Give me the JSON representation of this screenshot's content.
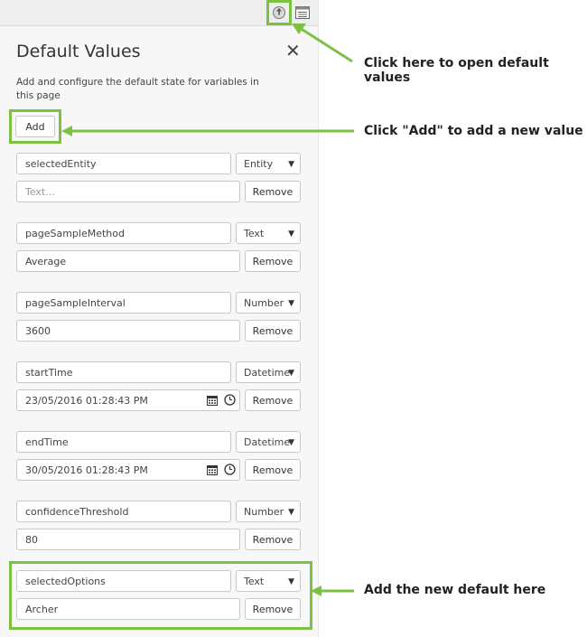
{
  "panel": {
    "title": "Default Values",
    "description": "Add and configure the default state for variables in this page",
    "add_label": "Add",
    "remove_label": "Remove",
    "rows": [
      {
        "name": "selectedEntity",
        "type": "Entity",
        "value": "",
        "placeholder": "Text..."
      },
      {
        "name": "pageSampleMethod",
        "type": "Text",
        "value": "Average"
      },
      {
        "name": "pageSampleInterval",
        "type": "Number",
        "value": "3600"
      },
      {
        "name": "startTime",
        "type": "Datetime",
        "value": "23/05/2016 01:28:43 PM"
      },
      {
        "name": "endTime",
        "type": "Datetime",
        "value": "30/05/2016 01:28:43 PM"
      },
      {
        "name": "confidenceThreshold",
        "type": "Number",
        "value": "80"
      },
      {
        "name": "selectedOptions",
        "type": "Text",
        "value": "Archer"
      }
    ]
  },
  "callouts": {
    "open": "Click here to open default values",
    "add": "Click \"Add\" to add a new value",
    "new_default": "Add the new default here"
  },
  "colors": {
    "highlight": "#7dc142"
  },
  "icons": [
    "default-values-icon",
    "panel-toggle-icon",
    "close-icon",
    "calendar-icon",
    "clock-icon",
    "chevron-down-icon"
  ]
}
